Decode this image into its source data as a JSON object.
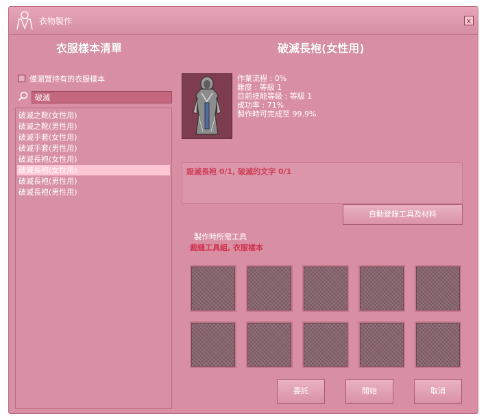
{
  "window": {
    "title": "衣物製作",
    "close_label": "x"
  },
  "left_panel": {
    "heading": "衣服樣本清單",
    "filter_checkbox_label": "僅瀏覽持有的衣服樣本",
    "search": {
      "value": "破滅"
    },
    "items": [
      {
        "label": "破滅之靴(女性用)"
      },
      {
        "label": "破滅之靴(男性用)"
      },
      {
        "label": "破滅手套(女性用)"
      },
      {
        "label": "破滅手套(男性用)"
      },
      {
        "label": "破滅長袍(女性用)"
      },
      {
        "label": "破滅長袍(女性用)",
        "selected": true
      },
      {
        "label": "破滅長袍(男性用)"
      },
      {
        "label": "破滅長袍(男性用)"
      }
    ]
  },
  "right_panel": {
    "heading": "破滅長袍(女性用)",
    "info": [
      "作業流程 : 0%",
      "難度 : 等級 1",
      "目前技能等級 : 等級 1",
      "成功率 : 71%",
      "製作時可完成至 99.9%"
    ],
    "materials_text": "毀滅長袍 0/1, 破滅的文字 0/1",
    "auto_register_button": "自動登錄工具及材料",
    "tools_label": "製作時所需工具",
    "tools_list": "裁縫工具組, 衣服樣本",
    "slot_count": 10
  },
  "buttons": {
    "commission": "委託",
    "start": "開始",
    "cancel": "取消"
  },
  "colors": {
    "window_bg": "#d98fa3",
    "accent_red": "#cf3f5b",
    "selected_row": "#ffc6d4"
  }
}
